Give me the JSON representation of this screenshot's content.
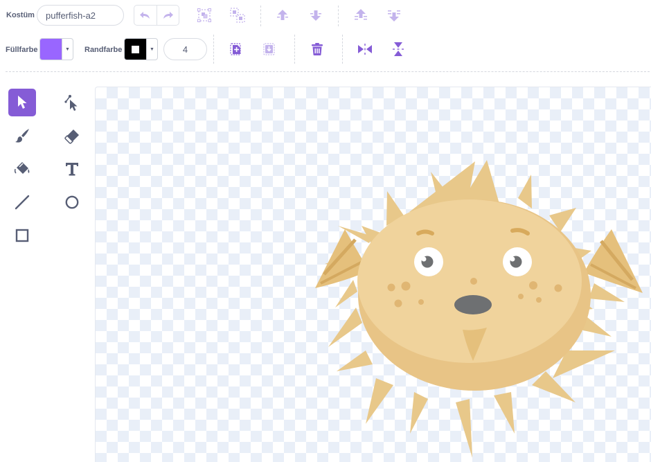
{
  "toolbar": {
    "costume_label": "Kostüm",
    "costume_name": "pufferfish-a2",
    "fill_label": "Füllfarbe",
    "outline_label": "Randfarbe",
    "outline_width": "4",
    "fill_color": "#9966ff",
    "outline_color": "#000000",
    "icons": [
      "undo-icon",
      "redo-icon",
      "group-icon",
      "ungroup-icon",
      "forward-icon",
      "backward-icon",
      "front-icon",
      "back-icon",
      "copy-icon",
      "paste-icon",
      "delete-icon",
      "flip-horizontal-icon",
      "flip-vertical-icon"
    ]
  },
  "tools": [
    "select",
    "reshape",
    "brush",
    "eraser",
    "fill",
    "text",
    "line",
    "circle",
    "rectangle"
  ],
  "selected_tool": "select",
  "colors": {
    "accent": "#855cd6",
    "icon": "#855cd6",
    "icon_dim": "#c3b3ec",
    "text": "#575e75"
  }
}
